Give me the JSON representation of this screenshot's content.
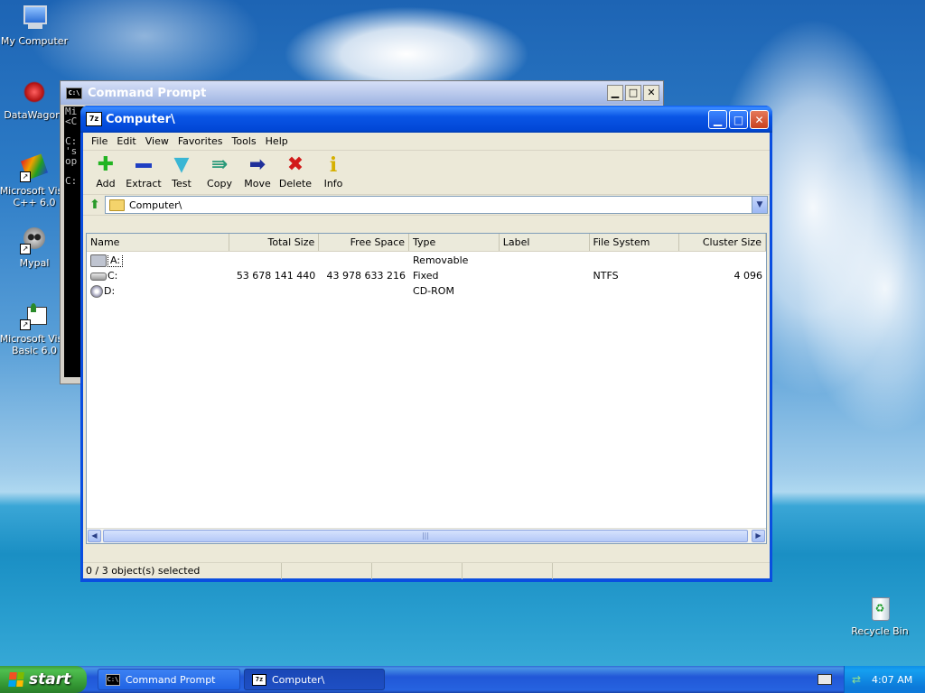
{
  "desktop": {
    "icons": [
      {
        "label": "My Computer"
      },
      {
        "label": "DataWagon."
      },
      {
        "label": "Microsoft Visu C++ 6.0"
      },
      {
        "label": "Mypal"
      },
      {
        "label": "Microsoft Visu Basic 6.0"
      },
      {
        "label": "Recycle Bin"
      }
    ]
  },
  "cmd_window": {
    "title": "Command Prompt",
    "icon_text": "C:\\",
    "console_text": "Mi\n<C\n\nC:\n's\nop\n\nC:"
  },
  "main_window": {
    "title": "Computer\\",
    "icon_text": "7z",
    "menu": [
      "File",
      "Edit",
      "View",
      "Favorites",
      "Tools",
      "Help"
    ],
    "toolbar": [
      {
        "label": "Add",
        "icon": "plus-icon",
        "color": "#22b422"
      },
      {
        "label": "Extract",
        "icon": "minus-icon",
        "color": "#1f3fc2"
      },
      {
        "label": "Test",
        "icon": "check-icon",
        "color": "#3ab6d4"
      },
      {
        "label": "Copy",
        "icon": "double-arrow-icon",
        "color": "#2a9a7a"
      },
      {
        "label": "Move",
        "icon": "arrow-right-icon",
        "color": "#1f2f9a"
      },
      {
        "label": "Delete",
        "icon": "x-icon",
        "color": "#d21a1a"
      },
      {
        "label": "Info",
        "icon": "info-icon",
        "color": "#d6b000"
      }
    ],
    "address": "Computer\\",
    "columns": [
      "Name",
      "Total Size",
      "Free Space",
      "Type",
      "Label",
      "File System",
      "Cluster Size"
    ],
    "rows": [
      {
        "name": "A:",
        "total": "",
        "free": "",
        "type": "Removable",
        "label": "",
        "fs": "",
        "cluster": "",
        "icon": "floppy-drive-icon"
      },
      {
        "name": "C:",
        "total": "53 678 141 440",
        "free": "43 978 633 216",
        "type": "Fixed",
        "label": "",
        "fs": "NTFS",
        "cluster": "4 096",
        "icon": "hard-drive-icon"
      },
      {
        "name": "D:",
        "total": "",
        "free": "",
        "type": "CD-ROM",
        "label": "",
        "fs": "",
        "cluster": "",
        "icon": "cd-drive-icon"
      }
    ],
    "status": "0 / 3 object(s) selected"
  },
  "taskbar": {
    "start_label": "start",
    "tasks": [
      {
        "label": "Command Prompt",
        "icon_text": "C:\\"
      },
      {
        "label": "Computer\\",
        "icon_text": "7z"
      }
    ],
    "clock": "4:07 AM"
  }
}
